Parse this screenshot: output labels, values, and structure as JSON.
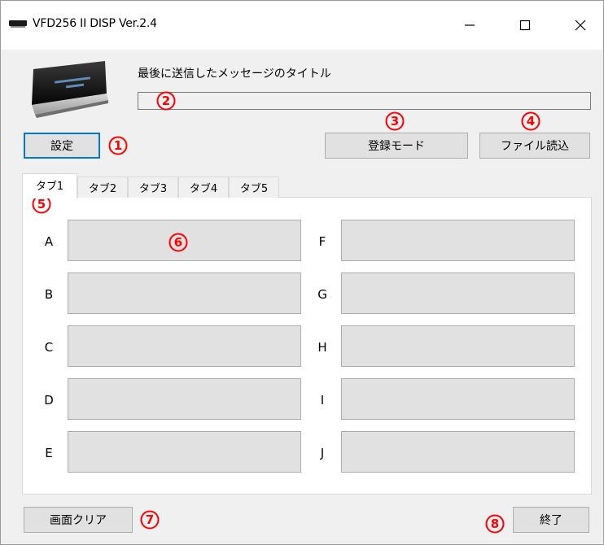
{
  "window": {
    "title": "VFD256 II DISP Ver.2.4",
    "controls": {
      "minimize": "—",
      "maximize": "☐",
      "close": "✕"
    }
  },
  "header": {
    "last_title_label": "最後に送信したメッセージのタイトル",
    "last_title_value": ""
  },
  "buttons": {
    "settings": "設定",
    "register_mode": "登録モード",
    "file_load": "ファイル読込",
    "clear_screen": "画面クリア",
    "exit": "終了"
  },
  "tabs": [
    {
      "label": "タブ1",
      "active": true
    },
    {
      "label": "タブ2",
      "active": false
    },
    {
      "label": "タブ3",
      "active": false
    },
    {
      "label": "タブ4",
      "active": false
    },
    {
      "label": "タブ5",
      "active": false
    }
  ],
  "slots": {
    "left": [
      {
        "label": "A",
        "value": ""
      },
      {
        "label": "B",
        "value": ""
      },
      {
        "label": "C",
        "value": ""
      },
      {
        "label": "D",
        "value": ""
      },
      {
        "label": "E",
        "value": ""
      }
    ],
    "right": [
      {
        "label": "F",
        "value": ""
      },
      {
        "label": "G",
        "value": ""
      },
      {
        "label": "H",
        "value": ""
      },
      {
        "label": "I",
        "value": ""
      },
      {
        "label": "J",
        "value": ""
      }
    ]
  },
  "annotations": [
    "1",
    "2",
    "3",
    "4",
    "5",
    "6",
    "7",
    "8"
  ],
  "colors": {
    "annotation": "#ff0000",
    "focus_border": "#0078d7",
    "button_face": "#e1e1e1",
    "window_bg": "#f0f0f0"
  },
  "icons": {
    "app": "vfd-device-icon",
    "device_image": "vfd-display-device"
  }
}
